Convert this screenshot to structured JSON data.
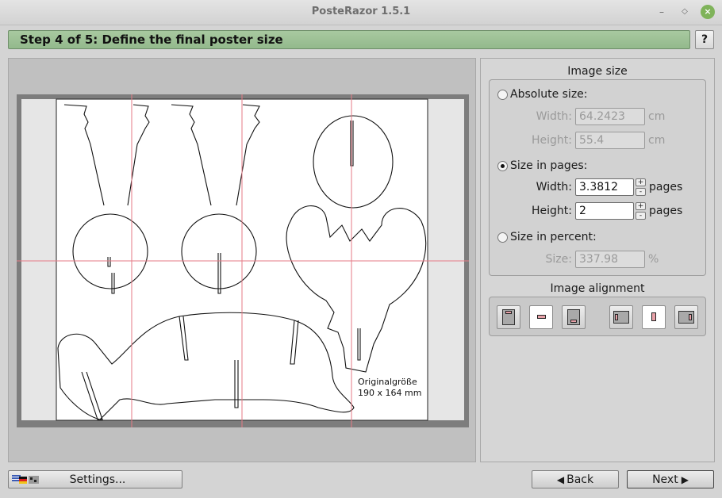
{
  "window": {
    "title": "PosteRazor 1.5.1"
  },
  "step": {
    "title": "Step 4 of 5: Define the final poster size",
    "help_label": "?"
  },
  "preview": {
    "annotation_line1": "Originalgröße",
    "annotation_line2": "190 x 164 mm"
  },
  "image_size": {
    "title": "Image size",
    "absolute": {
      "label": "Absolute size:",
      "width_label": "Width:",
      "width_value": "64.2423",
      "width_unit": "cm",
      "height_label": "Height:",
      "height_value": "55.4",
      "height_unit": "cm"
    },
    "pages": {
      "label": "Size in pages:",
      "width_label": "Width:",
      "width_value": "3.3812",
      "width_unit": "pages",
      "height_label": "Height:",
      "height_value": "2",
      "height_unit": "pages"
    },
    "percent": {
      "label": "Size in percent:",
      "size_label": "Size:",
      "size_value": "337.98",
      "size_unit": "%"
    },
    "selected_mode": "pages"
  },
  "alignment": {
    "title": "Image alignment",
    "selected_vertical": "center",
    "selected_horizontal": "center"
  },
  "bottom": {
    "settings_label": "Settings...",
    "back_label": "Back",
    "next_label": "Next"
  },
  "colors": {
    "step_bar": "#9cc095",
    "grid_line": "#e57a85",
    "accent_pink": "#e8a1a8"
  }
}
